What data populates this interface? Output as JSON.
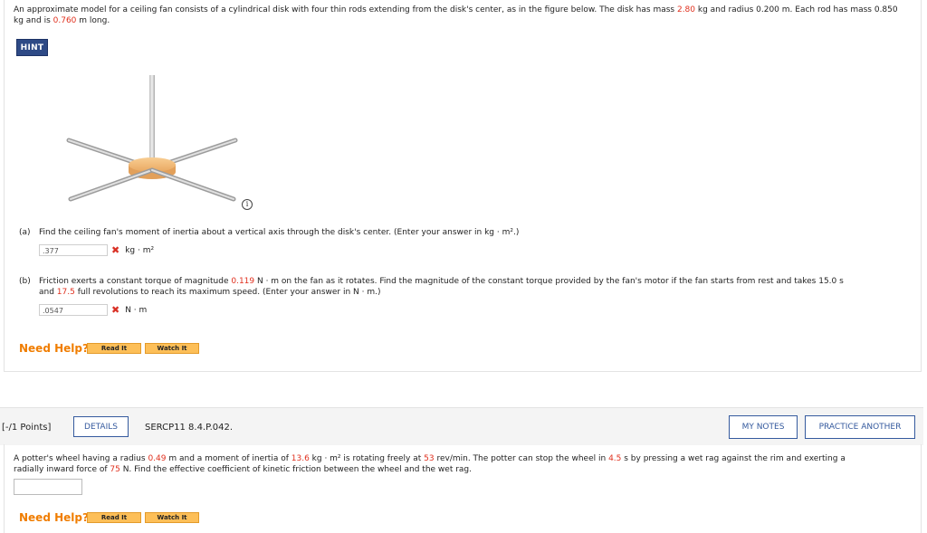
{
  "problem1": {
    "prompt_parts": [
      "An approximate model for a ceiling fan consists of a cylindrical disk with four thin rods extending from the disk's center, as in the figure below. The disk has mass ",
      "2.80",
      " kg and radius 0.200 m. Each rod has mass 0.850 kg and is ",
      "0.760",
      " m long."
    ],
    "hint_label": "HINT",
    "info_glyph": "i",
    "part_a": {
      "label": "(a)",
      "text": "Find the ceiling fan's moment of inertia about a vertical axis through the disk's center. (Enter your answer in kg · m².)",
      "answer": ".377",
      "unit": "kg · m²",
      "status": "incorrect"
    },
    "part_b": {
      "label": "(b)",
      "text_parts": [
        "Friction exerts a constant torque of magnitude ",
        "0.119",
        " N · m on the fan as it rotates. Find the magnitude of the constant torque provided by the fan's motor if the fan starts from rest and takes 15.0 s",
        "and ",
        "17.5",
        " full revolutions to reach its maximum speed. (Enter your answer in N · m.)"
      ],
      "answer": ".0547",
      "unit": "N · m",
      "status": "incorrect"
    },
    "need_help": "Need Help?",
    "read_it": "Read It",
    "watch_it": "Watch It"
  },
  "problem2": {
    "points": "[-/1 Points]",
    "details_label": "DETAILS",
    "question_id": "SERCP11 8.4.P.042.",
    "my_notes": "MY NOTES",
    "practice_another": "PRACTICE ANOTHER",
    "prompt_parts": [
      "A potter's wheel having a radius ",
      "0.49",
      " m and a moment of inertia of ",
      "13.6",
      " kg · m² is rotating freely at ",
      "53",
      " rev/min. The potter can stop the wheel in ",
      "4.5",
      " s by pressing a wet rag against the rim and exerting a",
      "radially inward force of ",
      "75",
      " N. Find the effective coefficient of kinetic friction between the wheel and the wet rag."
    ],
    "answer": "",
    "need_help": "Need Help?",
    "read_it": "Read It",
    "watch_it": "Watch It"
  },
  "colors": {
    "accent_blue": "#355a9e",
    "hint_blue": "#2e4a86",
    "highlight_red": "#e0301e",
    "help_orange": "#f07d00",
    "button_orange": "#fdbf58",
    "disk_orange": "#f6bf7c"
  }
}
